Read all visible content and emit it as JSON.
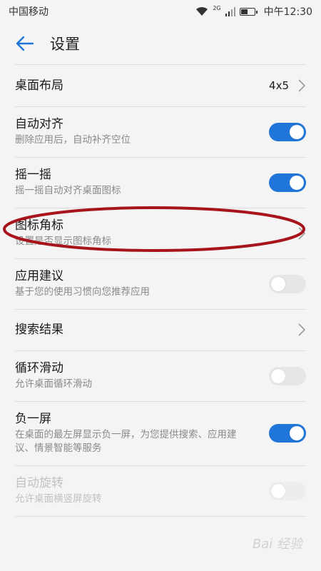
{
  "status": {
    "carrier": "中国移动",
    "network": "2G",
    "time": "中午12:30"
  },
  "header": {
    "title": "设置"
  },
  "settings": {
    "items": [
      {
        "title": "桌面布局",
        "value": "4x5",
        "type": "chevron"
      },
      {
        "title": "自动对齐",
        "subtitle": "删除应用后，自动补齐空位",
        "type": "toggle",
        "on": true
      },
      {
        "title": "摇一摇",
        "subtitle": "摇一摇自动对齐桌面图标",
        "type": "toggle",
        "on": true
      },
      {
        "title": "图标角标",
        "subtitle": "设置是否显示图标角标",
        "type": "chevron"
      },
      {
        "title": "应用建议",
        "subtitle": "基于您的使用习惯向您推荐应用",
        "type": "toggle",
        "on": false
      },
      {
        "title": "搜索结果",
        "type": "chevron"
      },
      {
        "title": "循环滑动",
        "subtitle": "允许桌面循环滑动",
        "type": "toggle",
        "on": false
      },
      {
        "title": "负一屏",
        "subtitle": "在桌面的最左屏显示负一屏，为您提供搜索、应用建议、情景智能等服务",
        "type": "toggle",
        "on": true
      },
      {
        "title": "自动旋转",
        "subtitle": "允许桌面横竖屏旋转",
        "type": "toggle",
        "on": false,
        "disabled": true
      }
    ]
  },
  "watermark": "Bai 经验",
  "colors": {
    "accent": "#1f76d8",
    "annotation": "#a8141c"
  }
}
